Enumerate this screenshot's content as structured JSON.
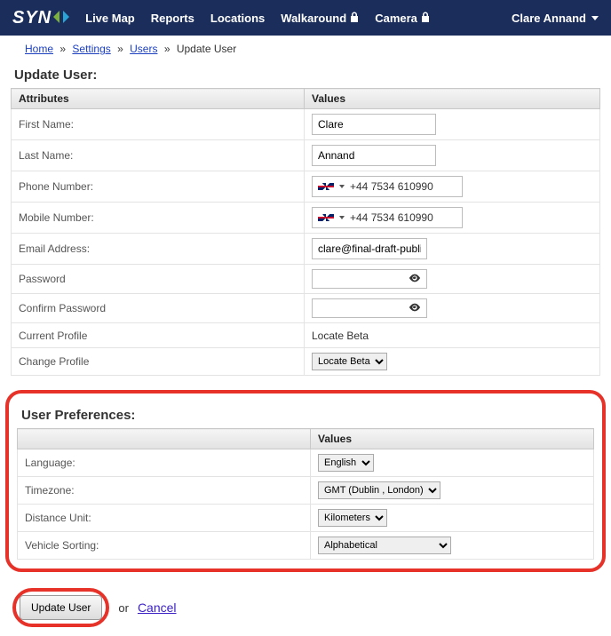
{
  "brand": "SYN",
  "nav": {
    "live_map": "Live Map",
    "reports": "Reports",
    "locations": "Locations",
    "walkaround": "Walkaround",
    "camera": "Camera"
  },
  "user_menu": "Clare Annand",
  "breadcrumb": {
    "home": "Home",
    "settings": "Settings",
    "users": "Users",
    "current": "Update User"
  },
  "heading_update_user": "Update User:",
  "columns": {
    "attributes": "Attributes",
    "values": "Values"
  },
  "fields": {
    "first_name": {
      "label": "First Name:",
      "value": "Clare"
    },
    "last_name": {
      "label": "Last Name:",
      "value": "Annand"
    },
    "phone": {
      "label": "Phone Number:",
      "value": "+44 7534 610990"
    },
    "mobile": {
      "label": "Mobile Number:",
      "value": "+44 7534 610990"
    },
    "email": {
      "label": "Email Address:",
      "value": "clare@final-draft-publishing"
    },
    "password": {
      "label": "Password"
    },
    "confirm_password": {
      "label": "Confirm Password"
    },
    "current_profile": {
      "label": "Current Profile",
      "value": "Locate Beta"
    },
    "change_profile": {
      "label": "Change Profile",
      "value": "Locate Beta"
    }
  },
  "heading_prefs": "User Preferences:",
  "prefs": {
    "language": {
      "label": "Language:",
      "value": "English"
    },
    "timezone": {
      "label": "Timezone:",
      "value": "GMT (Dublin , London)"
    },
    "distance": {
      "label": "Distance Unit:",
      "value": "Kilometers"
    },
    "sorting": {
      "label": "Vehicle Sorting:",
      "value": "Alphabetical"
    }
  },
  "footer": {
    "update_btn": "Update User",
    "or": "or",
    "cancel": "Cancel"
  }
}
